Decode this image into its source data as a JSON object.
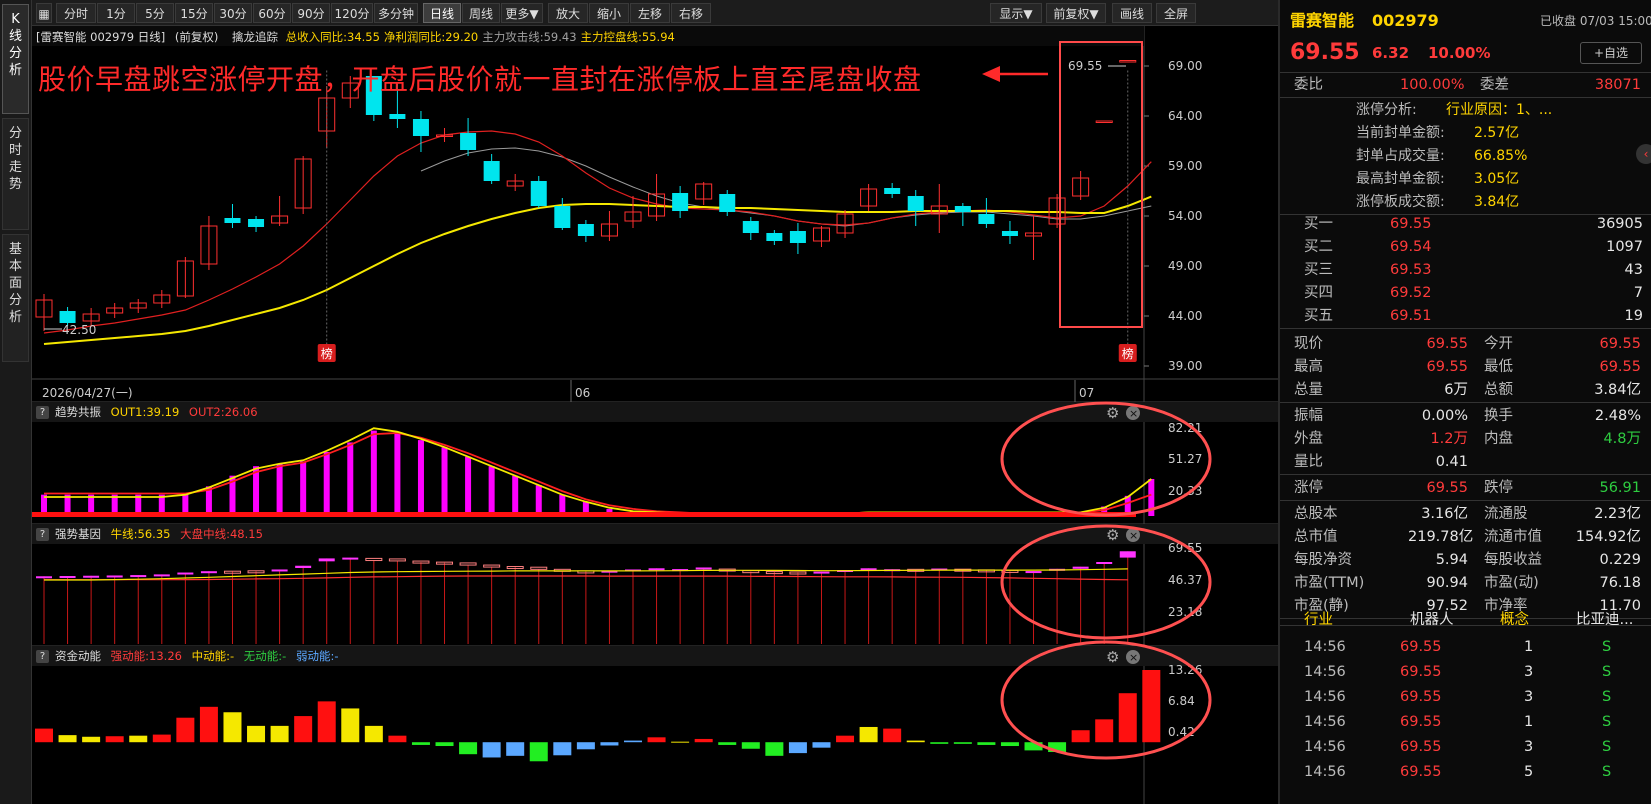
{
  "left_tabs": [
    "K\n线\n分\n析",
    "分\n时\n走\n势",
    "基\n本\n面\n分\n析"
  ],
  "toolbar": {
    "left": [
      "分时",
      "1分",
      "5分",
      "15分",
      "30分",
      "60分",
      "90分",
      "120分",
      "多分钟",
      "日线",
      "周线",
      "更多▼",
      "放大",
      "缩小",
      "左移",
      "右移"
    ],
    "active": "日线",
    "right": [
      "显示▼",
      "前复权▼",
      "画线",
      "全屏"
    ]
  },
  "info_line": {
    "stock": "[雷赛智能 002979 日线]",
    "adjust": "(前复权)",
    "indicator": "擒龙追踪",
    "items": [
      {
        "text": "总收入同比:34.55",
        "color": "#ffd400"
      },
      {
        "text": "净利润同比:29.20",
        "color": "#ffd400"
      },
      {
        "text": "主力攻击线:59.43",
        "color": "#a0a0a0"
      },
      {
        "text": "主力控盘线:55.94",
        "color": "#ffd400"
      }
    ]
  },
  "annotation": "股价早盘跳空涨停开盘，开盘后股价就一直封在涨停板上直至尾盘收盘",
  "date_axis": {
    "first": "2026/04/27(一)",
    "marks": [
      "06",
      "07"
    ]
  },
  "badge_text": "榜",
  "last_price_label": "69.55",
  "low_label": "42.50",
  "price_ticks": [
    "69.00",
    "64.00",
    "59.00",
    "54.00",
    "49.00",
    "44.00",
    "39.00"
  ],
  "sub1": {
    "name": "趋势共振",
    "out1": "OUT1:39.19",
    "out2": "OUT2:26.06",
    "ticks": [
      "82.21",
      "51.27",
      "20.33"
    ]
  },
  "sub2": {
    "name": "强势基因",
    "bull": "牛线:56.35",
    "market": "大盘中线:48.15",
    "ticks": [
      "69.55",
      "46.37",
      "23.18"
    ]
  },
  "sub3": {
    "name": "资金动能",
    "strong": "强动能:13.26",
    "mid": "中动能:-",
    "none": "无动能:-",
    "weak": "弱动能:-",
    "ticks": [
      "13.26",
      "6.84",
      "0.42"
    ]
  },
  "chart_data": {
    "type": "candlestick",
    "price_axis": {
      "min": 39,
      "max": 69
    },
    "candles": [
      {
        "o": 43.9,
        "c": 45.6,
        "h": 46.2,
        "l": 42.5
      },
      {
        "o": 44.5,
        "c": 43.3,
        "h": 44.9,
        "l": 43.0
      },
      {
        "o": 43.5,
        "c": 44.2,
        "h": 44.8,
        "l": 43.0
      },
      {
        "o": 44.3,
        "c": 44.8,
        "h": 45.3,
        "l": 43.8
      },
      {
        "o": 44.8,
        "c": 45.3,
        "h": 45.7,
        "l": 44.3
      },
      {
        "o": 45.3,
        "c": 46.1,
        "h": 46.6,
        "l": 44.8
      },
      {
        "o": 46.0,
        "c": 49.5,
        "h": 49.9,
        "l": 45.8
      },
      {
        "o": 49.2,
        "c": 53.0,
        "h": 54.0,
        "l": 48.6
      },
      {
        "o": 53.8,
        "c": 53.3,
        "h": 55.2,
        "l": 52.8
      },
      {
        "o": 53.7,
        "c": 52.9,
        "h": 54.0,
        "l": 52.4
      },
      {
        "o": 53.3,
        "c": 54.0,
        "h": 56.0,
        "l": 53.0
      },
      {
        "o": 54.8,
        "c": 59.7,
        "h": 60.0,
        "l": 54.2
      },
      {
        "o": 62.5,
        "c": 65.8,
        "h": 67.0,
        "l": 60.8
      },
      {
        "o": 65.8,
        "c": 67.3,
        "h": 68.0,
        "l": 64.8
      },
      {
        "o": 68.0,
        "c": 64.1,
        "h": 68.0,
        "l": 63.5
      },
      {
        "o": 64.2,
        "c": 63.7,
        "h": 67.2,
        "l": 62.8
      },
      {
        "o": 63.7,
        "c": 62.0,
        "h": 64.5,
        "l": 60.4
      },
      {
        "o": 62.0,
        "c": 62.1,
        "h": 62.8,
        "l": 61.4
      },
      {
        "o": 62.3,
        "c": 60.6,
        "h": 63.8,
        "l": 60.0
      },
      {
        "o": 59.5,
        "c": 57.5,
        "h": 60.2,
        "l": 57.2
      },
      {
        "o": 57.0,
        "c": 57.5,
        "h": 58.2,
        "l": 56.5
      },
      {
        "o": 57.5,
        "c": 55.0,
        "h": 58.0,
        "l": 54.8
      },
      {
        "o": 55.0,
        "c": 52.8,
        "h": 55.8,
        "l": 52.6
      },
      {
        "o": 53.2,
        "c": 52.0,
        "h": 53.6,
        "l": 51.4
      },
      {
        "o": 52.0,
        "c": 53.2,
        "h": 54.5,
        "l": 51.5
      },
      {
        "o": 53.5,
        "c": 54.4,
        "h": 56.0,
        "l": 52.8
      },
      {
        "o": 54.0,
        "c": 56.2,
        "h": 58.2,
        "l": 53.5
      },
      {
        "o": 56.3,
        "c": 54.5,
        "h": 57.0,
        "l": 53.8
      },
      {
        "o": 55.7,
        "c": 57.2,
        "h": 57.4,
        "l": 55.1
      },
      {
        "o": 56.2,
        "c": 54.4,
        "h": 56.6,
        "l": 54.0
      },
      {
        "o": 53.5,
        "c": 52.3,
        "h": 53.9,
        "l": 51.6
      },
      {
        "o": 52.3,
        "c": 51.5,
        "h": 52.6,
        "l": 51.1
      },
      {
        "o": 52.5,
        "c": 51.3,
        "h": 53.3,
        "l": 50.2
      },
      {
        "o": 51.5,
        "c": 52.8,
        "h": 53.0,
        "l": 50.9
      },
      {
        "o": 52.3,
        "c": 54.2,
        "h": 54.6,
        "l": 51.8
      },
      {
        "o": 55.0,
        "c": 56.7,
        "h": 57.2,
        "l": 54.5
      },
      {
        "o": 56.8,
        "c": 56.2,
        "h": 57.3,
        "l": 55.8
      },
      {
        "o": 56.0,
        "c": 54.5,
        "h": 56.6,
        "l": 53.0
      },
      {
        "o": 54.2,
        "c": 55.0,
        "h": 57.2,
        "l": 52.3
      },
      {
        "o": 55.0,
        "c": 54.4,
        "h": 55.3,
        "l": 53.0
      },
      {
        "o": 54.2,
        "c": 53.2,
        "h": 55.8,
        "l": 52.8
      },
      {
        "o": 52.5,
        "c": 52.0,
        "h": 53.5,
        "l": 51.2
      },
      {
        "o": 52.0,
        "c": 52.3,
        "h": 54.0,
        "l": 49.6
      },
      {
        "o": 53.2,
        "c": 55.8,
        "h": 56.2,
        "l": 52.8
      },
      {
        "o": 56.0,
        "c": 57.8,
        "h": 58.5,
        "l": 55.6
      },
      {
        "o": 63.5,
        "c": 63.5,
        "h": 63.5,
        "l": 63.5
      },
      {
        "o": 69.55,
        "c": 69.55,
        "h": 69.55,
        "l": 69.55
      }
    ],
    "ma_red": [
      42.3,
      42.6,
      43.0,
      43.3,
      43.7,
      44.1,
      44.6,
      45.6,
      46.7,
      47.9,
      49.2,
      51.0,
      53.2,
      55.6,
      58.0,
      60.0,
      61.3,
      62.1,
      62.4,
      62.5,
      62.2,
      61.4,
      60.0,
      58.3,
      56.8,
      55.8,
      55.2,
      54.8,
      54.7,
      54.6,
      54.4,
      54.0,
      53.5,
      53.2,
      53.1,
      53.3,
      53.8,
      54.2,
      54.4,
      54.5,
      54.6,
      54.4,
      54.1,
      53.8,
      54.0,
      55.0,
      57.0,
      59.43
    ],
    "ma_gray": [
      null,
      null,
      null,
      null,
      null,
      null,
      null,
      null,
      null,
      null,
      null,
      null,
      null,
      null,
      null,
      null,
      58.5,
      59.5,
      60.3,
      60.7,
      60.8,
      60.5,
      59.9,
      59.0,
      57.9,
      56.9,
      56.0,
      55.3,
      54.9,
      54.6,
      54.3,
      54.0,
      53.5,
      53.2,
      53.0,
      53.3,
      53.8,
      54.1,
      54.3,
      54.4,
      54.4,
      54.2,
      54.0,
      53.7,
      53.7,
      54.0,
      54.5,
      55.0
    ],
    "ma_yellow": [
      41.2,
      41.4,
      41.6,
      41.8,
      42.0,
      42.2,
      42.5,
      43.0,
      43.6,
      44.2,
      44.8,
      45.6,
      46.6,
      47.8,
      49.0,
      50.2,
      51.3,
      52.2,
      53.0,
      53.7,
      54.3,
      54.8,
      55.1,
      55.2,
      55.2,
      55.1,
      55.0,
      54.9,
      54.9,
      54.8,
      54.8,
      54.7,
      54.6,
      54.5,
      54.4,
      54.4,
      54.4,
      54.5,
      54.5,
      54.5,
      54.5,
      54.5,
      54.4,
      54.4,
      54.3,
      54.3,
      55.0,
      55.94
    ],
    "sub1_axis": {
      "min": 8,
      "max": 82.21
    },
    "sub1_bars": [
      26,
      26,
      26,
      26,
      26,
      26,
      27,
      33,
      42,
      50,
      52,
      54,
      62,
      70,
      80,
      78,
      72,
      66,
      58,
      50,
      42,
      34,
      26,
      20,
      14,
      12,
      11,
      10,
      10,
      10,
      10,
      10,
      10,
      10,
      10,
      11,
      11,
      11,
      11,
      11,
      11,
      11,
      11,
      11,
      11,
      16,
      25,
      39.19
    ],
    "sub1_yellow": [
      24,
      24,
      24,
      24,
      24,
      24,
      26,
      32,
      40,
      48,
      52,
      55,
      63,
      72,
      82,
      79,
      73,
      66,
      58,
      50,
      42,
      34,
      26,
      20,
      15,
      12,
      11,
      10,
      10,
      10,
      10,
      10,
      10,
      10,
      10,
      11,
      11,
      11,
      11,
      11,
      11,
      11,
      11,
      11,
      11,
      15,
      24,
      39.19
    ],
    "sub1_red": [
      27,
      27,
      27,
      27,
      27,
      27,
      27,
      30,
      37,
      45,
      50,
      53,
      60,
      68,
      77,
      78,
      74,
      68,
      61,
      53,
      45,
      37,
      29,
      22,
      17,
      14,
      12,
      11,
      10,
      10,
      10,
      10,
      10,
      10,
      10,
      11,
      11,
      11,
      11,
      11,
      11,
      11,
      11,
      11,
      11,
      13,
      19,
      26.06
    ],
    "sub2_axis": {
      "min": 0,
      "max": 75
    },
    "sub2_open": [
      50.2,
      50.6,
      50.8,
      51.0,
      51.2,
      51.6,
      52.6,
      53.6,
      54.6,
      54.9,
      55.4,
      57.0,
      62.0,
      63.9,
      64.2,
      63.8,
      62.2,
      61.4,
      60.8,
      59.2,
      58.1,
      57.6,
      56.0,
      54.8,
      54.3,
      55.0,
      55.9,
      56.1,
      56.8,
      56.2,
      55.0,
      54.3,
      54.0,
      54.0,
      54.3,
      55.5,
      56.1,
      56.0,
      56.3,
      56.1,
      55.6,
      55.2,
      54.6,
      55.0,
      56.4,
      60.8,
      64.8
    ],
    "sub2_close": [
      50.8,
      51.0,
      51.2,
      51.4,
      51.7,
      52.2,
      53.6,
      54.6,
      54.3,
      54.6,
      55.9,
      58.7,
      64.2,
      64.8,
      62.6,
      62.6,
      61.4,
      61.0,
      59.2,
      58.1,
      57.6,
      56.0,
      54.8,
      54.3,
      55.0,
      55.9,
      56.8,
      56.2,
      57.4,
      55.5,
      54.3,
      54.0,
      53.5,
      54.3,
      55.5,
      56.8,
      56.1,
      55.5,
      56.6,
      55.8,
      55.2,
      54.6,
      54.7,
      56.4,
      58.0,
      61.5,
      69.55
    ],
    "sub2_bull": [
      48,
      48,
      48,
      48.3,
      48.6,
      49,
      49.5,
      50,
      50.6,
      51.2,
      51.8,
      52.4,
      53,
      53.6,
      54,
      54.2,
      54.4,
      54.5,
      54.6,
      54.7,
      54.8,
      54.8,
      54.8,
      54.8,
      54.8,
      54.8,
      54.9,
      55,
      55.2,
      55.3,
      55.3,
      55.2,
      55.1,
      55,
      55,
      55.1,
      55.2,
      55.3,
      55.4,
      55.4,
      55.4,
      55.4,
      55.4,
      55.5,
      55.7,
      56,
      56.35
    ],
    "sub2_market": [
      48.2,
      48.2,
      48.2,
      48.2,
      48.2,
      48.2,
      48.3,
      48.4,
      48.6,
      48.8,
      49,
      49.3,
      49.6,
      50,
      50.3,
      50.5,
      50.7,
      50.9,
      51,
      51,
      51,
      51,
      51,
      51,
      50.9,
      50.9,
      50.9,
      50.9,
      50.9,
      50.9,
      50.8,
      50.7,
      50.6,
      50.5,
      50.4,
      50.4,
      50.3,
      50.2,
      50.1,
      50,
      49.8,
      49.6,
      49.3,
      49,
      48.7,
      48.4,
      48.15
    ],
    "sub3_axis": {
      "min": -4,
      "max": 13.26
    },
    "sub3_bars": [
      2.5,
      1.3,
      1.0,
      1.1,
      1.2,
      1.4,
      4.5,
      6.5,
      5.5,
      3.0,
      3.0,
      4.8,
      7.5,
      6.2,
      3.0,
      1.2,
      -0.5,
      -0.7,
      -2.2,
      -2.8,
      -2.5,
      -3.5,
      -2.4,
      -1.3,
      -0.6,
      0.3,
      0.9,
      0.1,
      0.6,
      -0.5,
      -1.2,
      -2.5,
      -2.0,
      -1.0,
      1.2,
      2.8,
      2.5,
      0.3,
      -0.3,
      -0.3,
      -0.5,
      -0.7,
      -1.5,
      -1.8,
      2.2,
      4.2,
      9.0,
      13.26
    ],
    "sub3_colors": [
      "r",
      "y",
      "y",
      "r",
      "y",
      "r",
      "r",
      "r",
      "y",
      "y",
      "y",
      "r",
      "r",
      "y",
      "y",
      "r",
      "g",
      "g",
      "g",
      "b",
      "b",
      "g",
      "b",
      "b",
      "b",
      "b",
      "r",
      "y",
      "r",
      "g",
      "g",
      "g",
      "b",
      "b",
      "r",
      "y",
      "r",
      "y",
      "g",
      "g",
      "g",
      "g",
      "g",
      "g",
      "r",
      "r",
      "r",
      "r"
    ]
  },
  "panel": {
    "name": "雷赛智能",
    "code": "002979",
    "status": "已收盘 07/03 15:00",
    "price": "69.55",
    "change": "6.32",
    "pct": "10.00%",
    "fav": "+自选",
    "weibi_label": "委比",
    "weibi": "100.00%",
    "weicha_label": "委差",
    "weicha": "38071",
    "limit_analysis": [
      {
        "label": "涨停分析:",
        "value": "行业原因：1、..."
      },
      {
        "label": "当前封单金额:",
        "value": "2.57亿"
      },
      {
        "label": "封单占成交量:",
        "value": "66.85%"
      },
      {
        "label": "最高封单金额:",
        "value": "3.05亿"
      },
      {
        "label": "涨停板成交额:",
        "value": "3.84亿"
      }
    ],
    "bids": [
      {
        "label": "买一",
        "price": "69.55",
        "vol": "36905"
      },
      {
        "label": "买二",
        "price": "69.54",
        "vol": "1097"
      },
      {
        "label": "买三",
        "price": "69.53",
        "vol": "43"
      },
      {
        "label": "买四",
        "price": "69.52",
        "vol": "7"
      },
      {
        "label": "买五",
        "price": "69.51",
        "vol": "19"
      }
    ],
    "stats": [
      [
        {
          "l": "现价",
          "v": "69.55",
          "c": "red"
        },
        {
          "l": "今开",
          "v": "69.55",
          "c": "red"
        }
      ],
      [
        {
          "l": "最高",
          "v": "69.55",
          "c": "red"
        },
        {
          "l": "最低",
          "v": "69.55",
          "c": "red"
        }
      ],
      [
        {
          "l": "总量",
          "v": "6万",
          "c": "white"
        },
        {
          "l": "总额",
          "v": "3.84亿",
          "c": "white"
        }
      ]
    ],
    "stats2": [
      [
        {
          "l": "振幅",
          "v": "0.00%",
          "c": "white"
        },
        {
          "l": "换手",
          "v": "2.48%",
          "c": "white"
        }
      ],
      [
        {
          "l": "外盘",
          "v": "1.2万",
          "c": "red"
        },
        {
          "l": "内盘",
          "v": "4.8万",
          "c": "green"
        }
      ],
      [
        {
          "l": "量比",
          "v": "0.41",
          "c": "white"
        },
        {
          "l": "",
          "v": "",
          "c": "white"
        }
      ]
    ],
    "stats3": [
      [
        {
          "l": "涨停",
          "v": "69.55",
          "c": "red"
        },
        {
          "l": "跌停",
          "v": "56.91",
          "c": "green"
        }
      ]
    ],
    "stats4": [
      [
        {
          "l": "总股本",
          "v": "3.16亿",
          "c": "white"
        },
        {
          "l": "流通股",
          "v": "2.23亿",
          "c": "white"
        }
      ],
      [
        {
          "l": "总市值",
          "v": "219.78亿",
          "c": "white"
        },
        {
          "l": "流通市值",
          "v": "154.92亿",
          "c": "white"
        }
      ],
      [
        {
          "l": "每股净资",
          "v": "5.94",
          "c": "white"
        },
        {
          "l": "每股收益",
          "v": "0.229",
          "c": "white"
        }
      ],
      [
        {
          "l": "市盈(TTM)",
          "v": "90.94",
          "c": "white"
        },
        {
          "l": "市盈(动)",
          "v": "76.18",
          "c": "white"
        }
      ],
      [
        {
          "l": "市盈(静)",
          "v": "97.52",
          "c": "white"
        },
        {
          "l": "市净率",
          "v": "11.70",
          "c": "white"
        }
      ]
    ],
    "industry_label": "行业",
    "industry": "机器人",
    "concept_label": "概念",
    "concept": "比亚迪...",
    "ticks": [
      {
        "t": "14:56",
        "p": "69.55",
        "v": "1",
        "s": "S"
      },
      {
        "t": "14:56",
        "p": "69.55",
        "v": "3",
        "s": "S"
      },
      {
        "t": "14:56",
        "p": "69.55",
        "v": "3",
        "s": "S"
      },
      {
        "t": "14:56",
        "p": "69.55",
        "v": "1",
        "s": "S"
      },
      {
        "t": "14:56",
        "p": "69.55",
        "v": "3",
        "s": "S"
      },
      {
        "t": "14:56",
        "p": "69.55",
        "v": "5",
        "s": "S"
      }
    ]
  }
}
